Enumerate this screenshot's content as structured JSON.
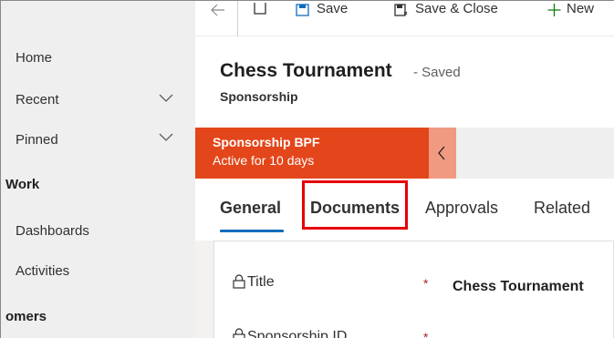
{
  "sidebar": {
    "items": [
      {
        "label": "Home"
      },
      {
        "label": "Recent"
      },
      {
        "label": "Pinned"
      }
    ],
    "section_work": "Work",
    "work_items": [
      {
        "label": "Dashboards"
      },
      {
        "label": "Activities"
      }
    ],
    "section_customers": "omers"
  },
  "commandbar": {
    "save_label": "Save",
    "save_close_label": "Save & Close",
    "new_label": "New"
  },
  "header": {
    "title": "Chess Tournament",
    "status": "- Saved",
    "entity": "Sponsorship"
  },
  "bpf": {
    "name": "Sponsorship BPF",
    "duration": "Active for 10 days"
  },
  "tabs": [
    {
      "label": "General",
      "selected": true
    },
    {
      "label": "Documents",
      "highlighted": true
    },
    {
      "label": "Approvals"
    },
    {
      "label": "Related"
    }
  ],
  "form": {
    "title_label": "Title",
    "title_required": "*",
    "title_value": "Chess Tournament",
    "second_label": "Sponsorship ID",
    "second_required": "*"
  },
  "colors": {
    "bpf_stage": "#e3461a",
    "bpf_collapse": "#f09a82",
    "tab_underline": "#0f6cbd",
    "highlight_box": "#e60000",
    "required": "#a4262c"
  },
  "icons": [
    "back-arrow-icon",
    "popout-icon",
    "save-icon",
    "save-close-icon",
    "new-icon",
    "chevron-down-icon",
    "chevron-left-icon",
    "lock-icon"
  ]
}
